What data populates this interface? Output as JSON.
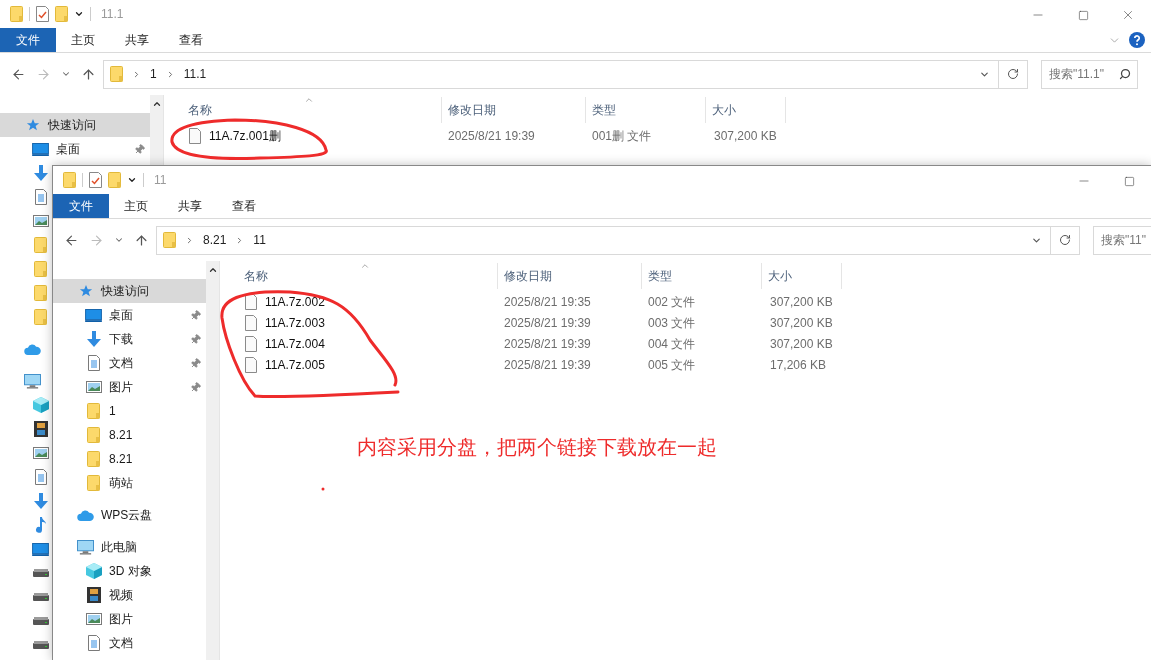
{
  "windows": [
    {
      "title": "11.1",
      "ribbon_tabs": [
        {
          "label": "文件",
          "kind": "file"
        },
        {
          "label": "主页",
          "kind": "tab"
        },
        {
          "label": "共享",
          "kind": "tab"
        },
        {
          "label": "查看",
          "kind": "tab"
        }
      ],
      "breadcrumb": [
        "1",
        "11.1"
      ],
      "search": {
        "placeholder": "搜索\"11.1\""
      },
      "sidebar": [
        {
          "kind": "quick",
          "label": "快速访问",
          "selected": true,
          "children": [
            {
              "kind": "desktop",
              "label": "桌面",
              "pinned": true,
              "selected": false
            },
            {
              "kind": "download",
              "selected": false
            },
            {
              "kind": "document",
              "selected": false
            },
            {
              "kind": "picture",
              "selected": false
            },
            {
              "kind": "folder",
              "selected": false
            },
            {
              "kind": "folder",
              "selected": false
            },
            {
              "kind": "folder",
              "selected": false
            },
            {
              "kind": "folder",
              "selected": false
            }
          ]
        },
        {
          "kind": "cloud",
          "selected": false
        },
        {
          "kind": "pc",
          "selected": false,
          "children": [
            {
              "kind": "cube",
              "selected": false
            },
            {
              "kind": "video",
              "selected": false
            },
            {
              "kind": "picture",
              "selected": false
            },
            {
              "kind": "document",
              "selected": false
            },
            {
              "kind": "download",
              "selected": false
            },
            {
              "kind": "music",
              "selected": false
            },
            {
              "kind": "desktop",
              "selected": false
            },
            {
              "kind": "drive",
              "selected": false
            },
            {
              "kind": "drive",
              "selected": false
            },
            {
              "kind": "drive",
              "selected": false
            },
            {
              "kind": "drive",
              "selected": false
            }
          ]
        }
      ],
      "columns": [
        "名称",
        "修改日期",
        "类型",
        "大小"
      ],
      "files": [
        {
          "name": "11A.7z.001删",
          "modified": "2025/8/21 19:39",
          "type": "001删 文件",
          "size": "307,200 KB"
        }
      ]
    },
    {
      "title": "11",
      "ribbon_tabs": [
        {
          "label": "文件",
          "kind": "file"
        },
        {
          "label": "主页",
          "kind": "tab"
        },
        {
          "label": "共享",
          "kind": "tab"
        },
        {
          "label": "查看",
          "kind": "tab"
        }
      ],
      "breadcrumb": [
        "8.21",
        "11"
      ],
      "search": {
        "placeholder": "搜索\"11\""
      },
      "sidebar": [
        {
          "kind": "quick",
          "label": "快速访问",
          "selected": true,
          "children": [
            {
              "kind": "desktop",
              "label": "桌面",
              "pinned": true,
              "selected": false
            },
            {
              "kind": "download",
              "label": "下载",
              "pinned": true,
              "selected": false
            },
            {
              "kind": "document",
              "label": "文档",
              "pinned": true,
              "selected": false
            },
            {
              "kind": "picture",
              "label": "图片",
              "pinned": true,
              "selected": false
            },
            {
              "kind": "folder",
              "label": "1",
              "pinned": false,
              "selected": false
            },
            {
              "kind": "folder",
              "label": "8.21",
              "pinned": false,
              "selected": false
            },
            {
              "kind": "folder",
              "label": "8.21",
              "pinned": false,
              "selected": false
            },
            {
              "kind": "folder",
              "label": "萌站",
              "pinned": false,
              "selected": false
            }
          ]
        },
        {
          "kind": "cloud",
          "label": "WPS云盘",
          "selected": false
        },
        {
          "kind": "pc",
          "label": "此电脑",
          "selected": false,
          "children": [
            {
              "kind": "cube",
              "label": "3D 对象",
              "selected": false
            },
            {
              "kind": "video",
              "label": "视频",
              "selected": false
            },
            {
              "kind": "picture",
              "label": "图片",
              "selected": false
            },
            {
              "kind": "document",
              "label": "文档",
              "selected": false
            }
          ]
        }
      ],
      "columns": [
        "名称",
        "修改日期",
        "类型",
        "大小"
      ],
      "files": [
        {
          "name": "11A.7z.002",
          "modified": "2025/8/21 19:35",
          "type": "002 文件",
          "size": "307,200 KB"
        },
        {
          "name": "11A.7z.003",
          "modified": "2025/8/21 19:39",
          "type": "003 文件",
          "size": "307,200 KB"
        },
        {
          "name": "11A.7z.004",
          "modified": "2025/8/21 19:39",
          "type": "004 文件",
          "size": "307,200 KB"
        },
        {
          "name": "11A.7z.005",
          "modified": "2025/8/21 19:39",
          "type": "005 文件",
          "size": "17,206 KB"
        }
      ]
    }
  ],
  "annotation": {
    "note": "内容采用分盘，把两个链接下载放在一起"
  }
}
